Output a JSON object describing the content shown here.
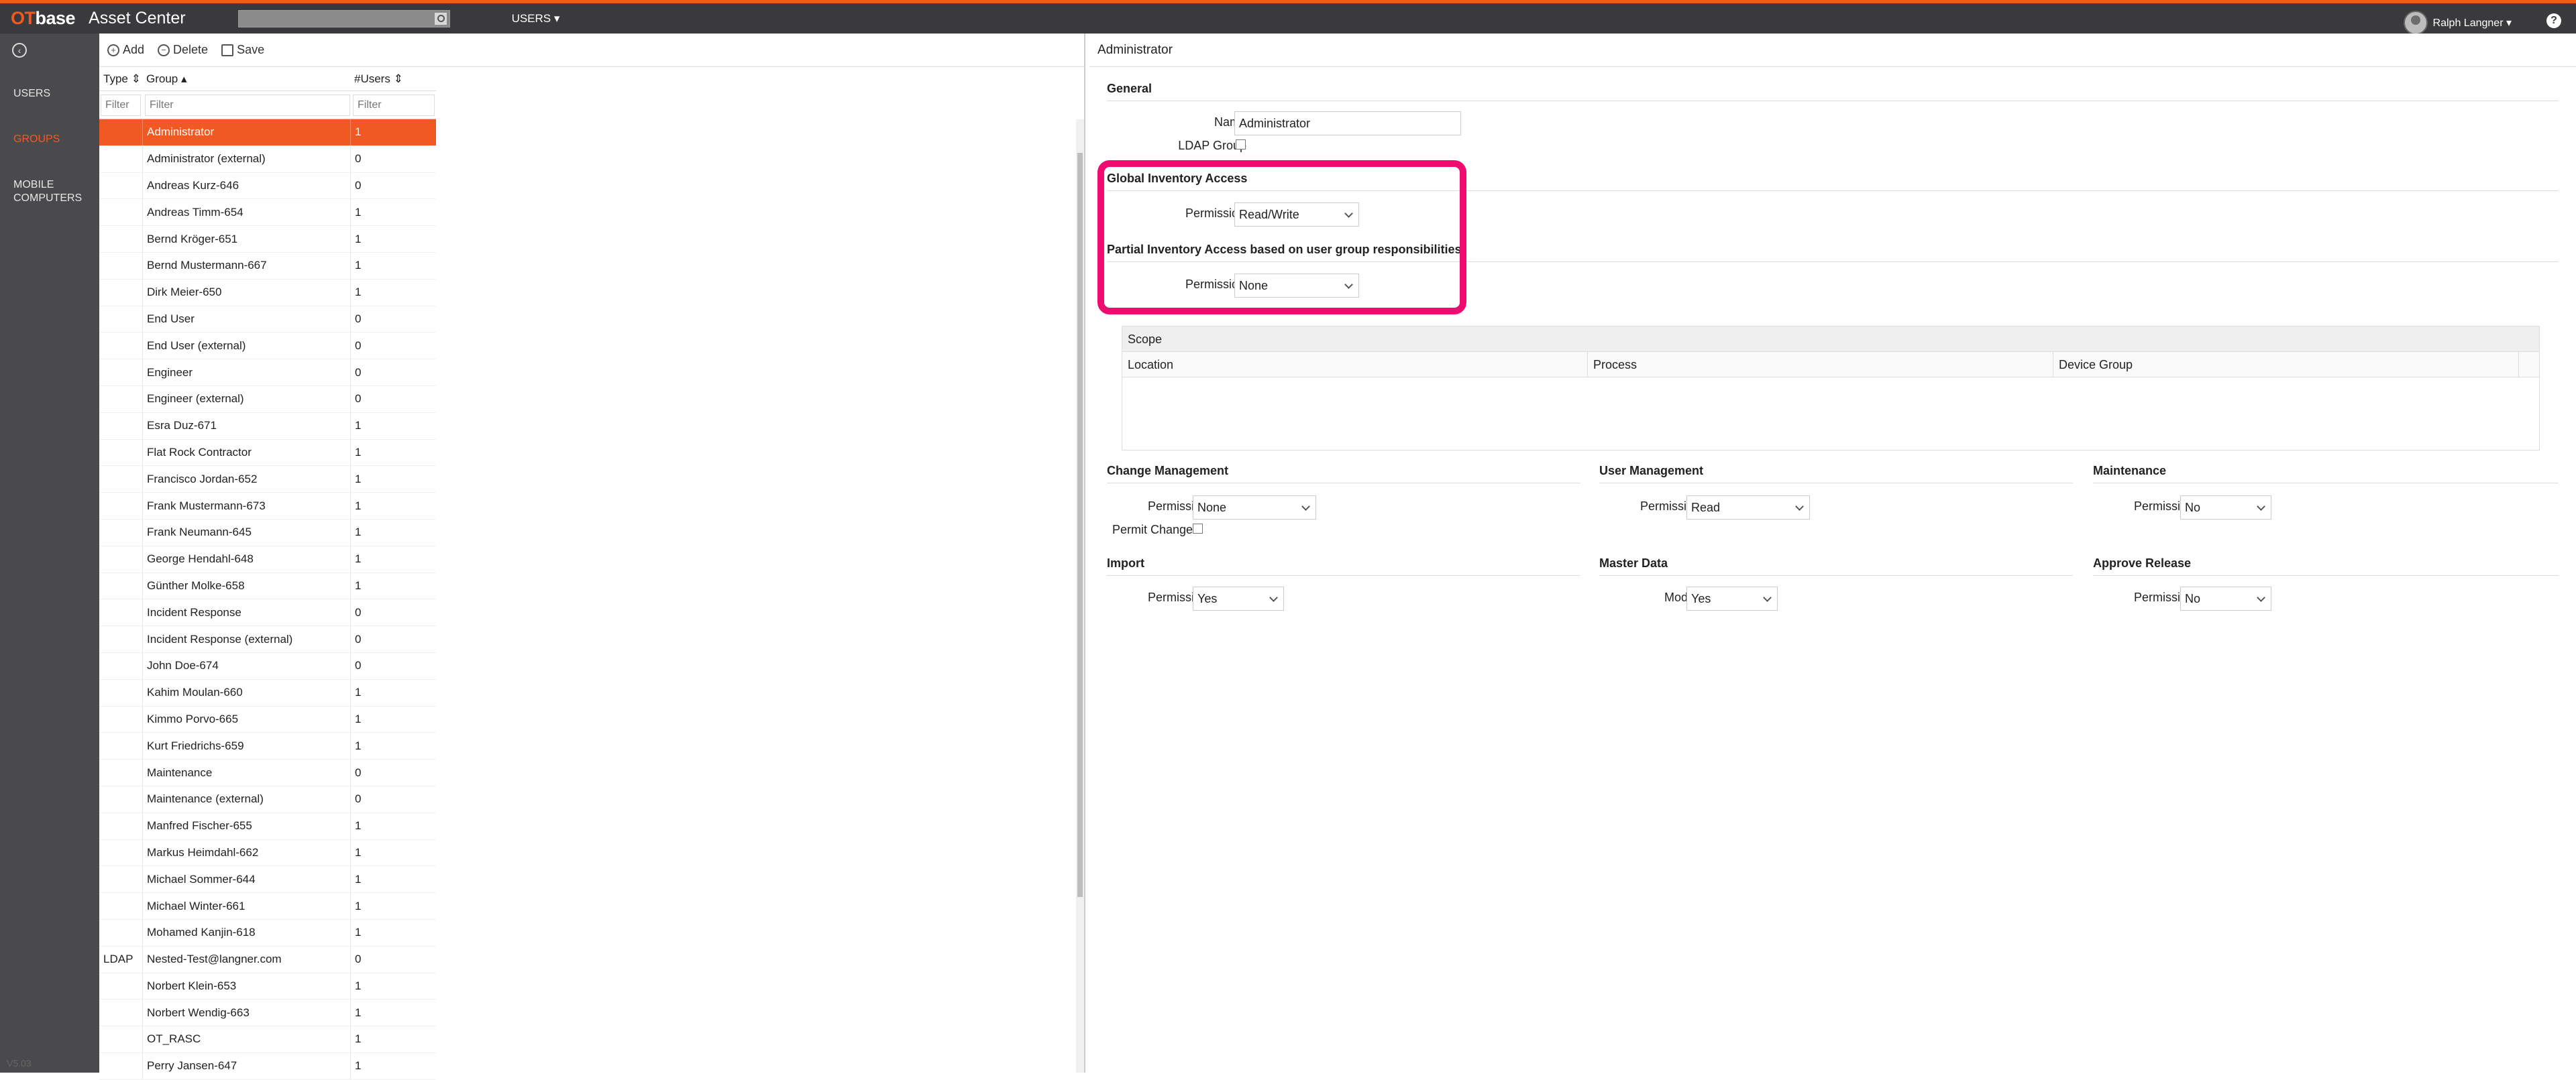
{
  "topbar": {
    "logo_prefix": "OT",
    "logo_suffix": "base",
    "app_title": "Asset Center",
    "search_value": "",
    "menu_label": "USERS ▾",
    "user_name": "Ralph Langner ▾",
    "help_label": "?"
  },
  "leftnav": {
    "back_icon": "back-arrow-icon",
    "items": [
      {
        "label": "USERS"
      },
      {
        "label": "GROUPS"
      },
      {
        "label": "MOBILE COMPUTERS"
      }
    ],
    "version": "V5.03"
  },
  "toolbar": {
    "add_label": "Add",
    "delete_label": "Delete",
    "save_label": "Save"
  },
  "table": {
    "headers": {
      "type": "Type ⇕",
      "group": "Group ▴",
      "users": "#Users ⇕"
    },
    "filter_placeholder": "Filter",
    "rows": [
      {
        "type": "",
        "group": "Administrator",
        "users": "1"
      },
      {
        "type": "",
        "group": "Administrator (external)",
        "users": "0"
      },
      {
        "type": "",
        "group": "Andreas Kurz-646",
        "users": "0"
      },
      {
        "type": "",
        "group": "Andreas Timm-654",
        "users": "1"
      },
      {
        "type": "",
        "group": "Bernd Kröger-651",
        "users": "1"
      },
      {
        "type": "",
        "group": "Bernd Mustermann-667",
        "users": "1"
      },
      {
        "type": "",
        "group": "Dirk Meier-650",
        "users": "1"
      },
      {
        "type": "",
        "group": "End User",
        "users": "0"
      },
      {
        "type": "",
        "group": "End User (external)",
        "users": "0"
      },
      {
        "type": "",
        "group": "Engineer",
        "users": "0"
      },
      {
        "type": "",
        "group": "Engineer (external)",
        "users": "0"
      },
      {
        "type": "",
        "group": "Esra Duz-671",
        "users": "1"
      },
      {
        "type": "",
        "group": "Flat Rock Contractor",
        "users": "1"
      },
      {
        "type": "",
        "group": "Francisco Jordan-652",
        "users": "1"
      },
      {
        "type": "",
        "group": "Frank Mustermann-673",
        "users": "1"
      },
      {
        "type": "",
        "group": "Frank Neumann-645",
        "users": "1"
      },
      {
        "type": "",
        "group": "George Hendahl-648",
        "users": "1"
      },
      {
        "type": "",
        "group": "Günther Molke-658",
        "users": "1"
      },
      {
        "type": "",
        "group": "Incident Response",
        "users": "0"
      },
      {
        "type": "",
        "group": "Incident Response (external)",
        "users": "0"
      },
      {
        "type": "",
        "group": "John Doe-674",
        "users": "0"
      },
      {
        "type": "",
        "group": "Kahim Moulan-660",
        "users": "1"
      },
      {
        "type": "",
        "group": "Kimmo Porvo-665",
        "users": "1"
      },
      {
        "type": "",
        "group": "Kurt Friedrichs-659",
        "users": "1"
      },
      {
        "type": "",
        "group": "Maintenance",
        "users": "0"
      },
      {
        "type": "",
        "group": "Maintenance (external)",
        "users": "0"
      },
      {
        "type": "",
        "group": "Manfred Fischer-655",
        "users": "1"
      },
      {
        "type": "",
        "group": "Markus Heimdahl-662",
        "users": "1"
      },
      {
        "type": "",
        "group": "Michael Sommer-644",
        "users": "1"
      },
      {
        "type": "",
        "group": "Michael Winter-661",
        "users": "1"
      },
      {
        "type": "",
        "group": "Mohamed Kanjin-618",
        "users": "1"
      },
      {
        "type": "LDAP",
        "group": "Nested-Test@langner.com",
        "users": "0"
      },
      {
        "type": "",
        "group": "Norbert Klein-653",
        "users": "1"
      },
      {
        "type": "",
        "group": "Norbert Wendig-663",
        "users": "1"
      },
      {
        "type": "",
        "group": "OT_RASC",
        "users": "1"
      },
      {
        "type": "",
        "group": "Perry Jansen-647",
        "users": "1"
      }
    ]
  },
  "detail": {
    "title": "Administrator",
    "general": {
      "title": "General",
      "name_label": "Name",
      "name_value": "Administrator",
      "ldap_label": "LDAP Group"
    },
    "global": {
      "title": "Global Inventory Access",
      "perm_label": "Permission",
      "perm_value": "Read/Write"
    },
    "partial": {
      "title": "Partial Inventory Access based on user group responsibilities",
      "perm_label": "Permission",
      "perm_value": "None"
    },
    "scope": {
      "title": "Scope",
      "cols": [
        "Location",
        "Process",
        "Device Group"
      ]
    },
    "change": {
      "title": "Change Management",
      "perm_label": "Permission",
      "perm_value": "None",
      "permit_label": "Permit Change"
    },
    "usermgmt": {
      "title": "User Management",
      "perm_label": "Permission",
      "perm_value": "Read"
    },
    "maint": {
      "title": "Maintenance",
      "perm_label": "Permission",
      "perm_value": "No"
    },
    "import": {
      "title": "Import",
      "perm_label": "Permission",
      "perm_value": "Yes"
    },
    "master": {
      "title": "Master Data",
      "perm_label": "Modify",
      "perm_value": "Yes"
    },
    "approve": {
      "title": "Approve Release",
      "perm_label": "Permission",
      "perm_value": "No"
    }
  },
  "colors": {
    "accent": "#f05a22",
    "highlight": "#ef0b6f",
    "topbar": "#3a3a3c",
    "nav": "#4a4a4c"
  }
}
